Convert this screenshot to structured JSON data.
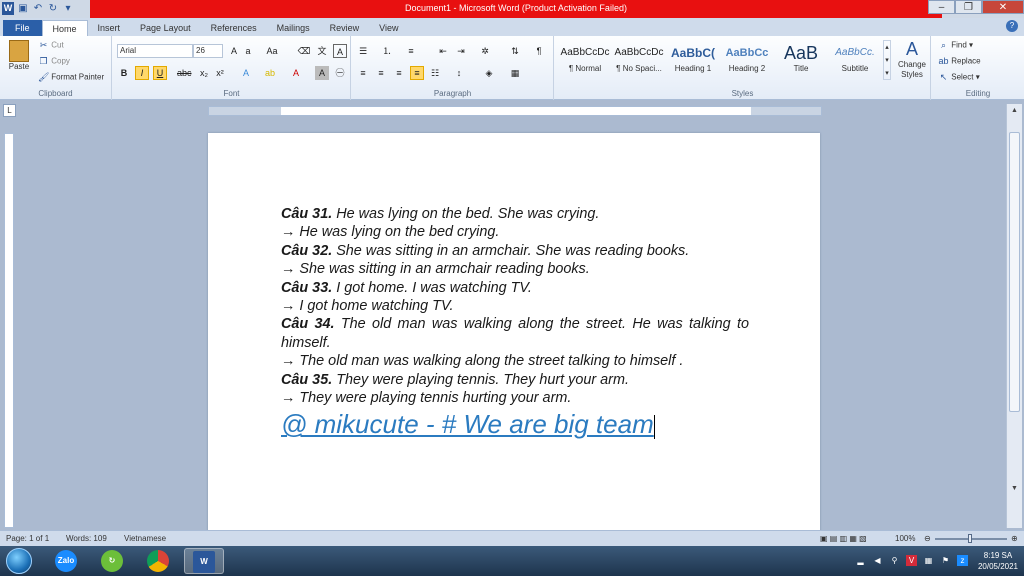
{
  "window": {
    "title": "Document1  -  Microsoft Word (Product Activation Failed)",
    "accent": "#e81010"
  },
  "tabs": [
    {
      "label": "File"
    },
    {
      "label": "Home"
    },
    {
      "label": "Insert"
    },
    {
      "label": "Page Layout"
    },
    {
      "label": "References"
    },
    {
      "label": "Mailings"
    },
    {
      "label": "Review"
    },
    {
      "label": "View"
    }
  ],
  "ribbon": {
    "clipboard": {
      "paste": "Paste",
      "cut": "Cut",
      "copy": "Copy",
      "format_painter": "Format Painter",
      "label": "Clipboard"
    },
    "font": {
      "name": "Arial",
      "size": "26",
      "label": "Font"
    },
    "paragraph": {
      "label": "Paragraph"
    },
    "styles": {
      "items": [
        {
          "preview": "AaBbCcDc",
          "name": "¶ Normal"
        },
        {
          "preview": "AaBbCcDc",
          "name": "¶ No Spaci..."
        },
        {
          "preview": "AaBbC(",
          "name": "Heading 1"
        },
        {
          "preview": "AaBbCc",
          "name": "Heading 2"
        },
        {
          "preview": "AaB",
          "name": "Title"
        },
        {
          "preview": "AaBbCc.",
          "name": "Subtitle"
        }
      ],
      "change_styles": "Change Styles",
      "label": "Styles"
    },
    "editing": {
      "find": "Find",
      "replace": "Replace",
      "select": "Select",
      "label": "Editing"
    }
  },
  "document": {
    "lines": [
      {
        "label": "Câu 31.",
        "text": " He was lying on the bed. She was crying."
      },
      {
        "text": "→ He was lying on the bed  crying."
      },
      {
        "label": "Câu 32.",
        "text": " She was sitting in an armchair. She was reading books."
      },
      {
        "text": "→ She was sitting in an armchair reading books."
      },
      {
        "label": "Câu 33.",
        "text": " I got home. I was watching TV."
      },
      {
        "text": "→ I got home watching TV."
      },
      {
        "label": "Câu 34.",
        "text": " The old man was walking along the street. He was talking to himself."
      },
      {
        "text": "→ The old man was walking along the street talking to himself ."
      },
      {
        "label": "Câu 35.",
        "text": " They were playing tennis. They hurt your arm."
      },
      {
        "text": "→ They were playing tennis hurting your arm."
      }
    ],
    "signature": "@ mikucute - # We are big team",
    "signature_color": "#2b7bc0"
  },
  "status": {
    "page": "Page: 1 of 1",
    "words": "Words: 109",
    "language": "Vietnamese",
    "zoom": "100%"
  },
  "taskbar": {
    "apps": [
      {
        "name": "Zalo"
      },
      {
        "name": "Chrome"
      },
      {
        "name": "W"
      }
    ],
    "time": "8:19 SA",
    "date": "20/05/2021"
  }
}
